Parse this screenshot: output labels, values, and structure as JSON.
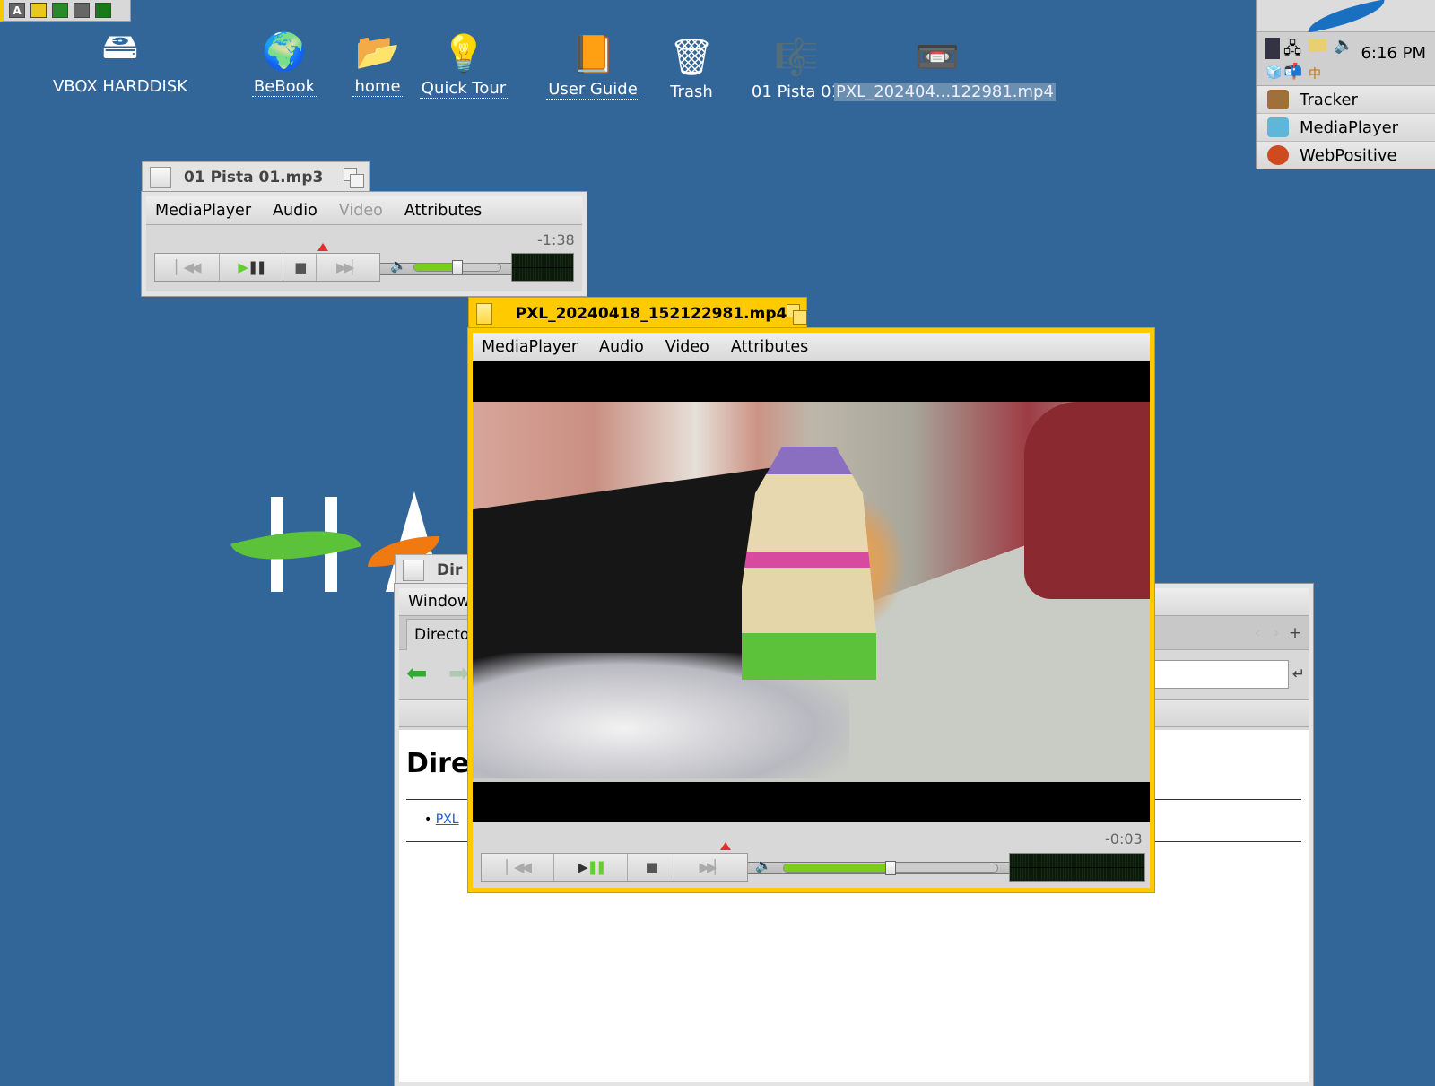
{
  "deskbar_mini": {
    "icons": [
      "A",
      "note",
      "moon",
      "dots",
      "list"
    ]
  },
  "desktop_icons": [
    {
      "label": "VBOX HARDDISK",
      "icon": "harddisk-icon",
      "link": false,
      "selected": false
    },
    {
      "label": "BeBook",
      "icon": "globe-book-icon",
      "link": true,
      "selected": false
    },
    {
      "label": "home",
      "icon": "home-folder-icon",
      "link": true,
      "selected": false
    },
    {
      "label": "Quick Tour",
      "icon": "lightbulb-icon",
      "link": true,
      "selected": false
    },
    {
      "label": "User Guide",
      "icon": "book-icon",
      "link": true,
      "selected": false
    },
    {
      "label": "Trash",
      "icon": "trash-icon",
      "link": false,
      "selected": false
    },
    {
      "label": "01 Pista 01",
      "icon": "audio-file-icon",
      "link": false,
      "selected": false
    },
    {
      "label": "PXL_202404...122981.mp4",
      "icon": "video-file-icon",
      "link": false,
      "selected": true
    }
  ],
  "tray": {
    "clock": "6:16 PM",
    "apps": [
      {
        "label": "Tracker",
        "color": "#a0703a"
      },
      {
        "label": "MediaPlayer",
        "color": "#5fb6d8"
      },
      {
        "label": "WebPositive",
        "color": "#d04a20"
      }
    ]
  },
  "audio_player": {
    "title": "01 Pista 01.mp3",
    "menu": [
      "MediaPlayer",
      "Audio",
      "Video",
      "Attributes"
    ],
    "disabled_menu": "Video",
    "time_left": "-1:38",
    "progress": 0.445,
    "volume": 0.5
  },
  "video_player": {
    "title": "PXL_20240418_152122981.mp4",
    "menu": [
      "MediaPlayer",
      "Audio",
      "Video",
      "Attributes"
    ],
    "time_left": "-0:03",
    "progress": 0.395,
    "volume": 0.5
  },
  "browser": {
    "title": "Dir",
    "menu": "Window",
    "tab": "Director",
    "heading": "Direc",
    "link": "PXL"
  },
  "haiku_logo": "HA",
  "colors": {
    "desktop": "#336698",
    "active_tab": "#ffcb00",
    "volume_fill": "#7ccc1c"
  }
}
